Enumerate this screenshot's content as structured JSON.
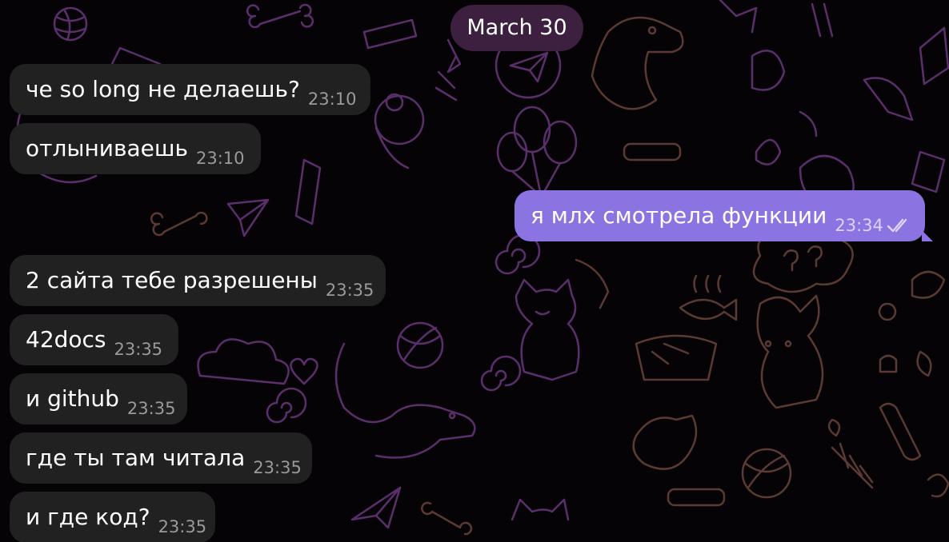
{
  "date_separator": "March 30",
  "messages": [
    {
      "direction": "incoming",
      "text": "че so long не делаешь?",
      "time": "23:10"
    },
    {
      "direction": "incoming",
      "text": "отлыниваешь",
      "time": "23:10"
    },
    {
      "direction": "outgoing",
      "text": "я млх смотрела функции",
      "time": "23:34",
      "status_icon": "double-check-icon"
    },
    {
      "direction": "incoming",
      "text": "2 сайта тебе разрешены",
      "time": "23:35"
    },
    {
      "direction": "incoming",
      "text": "42docs",
      "time": "23:35"
    },
    {
      "direction": "incoming",
      "text": "и github",
      "time": "23:35"
    },
    {
      "direction": "incoming",
      "text": "где ты там читала",
      "time": "23:35"
    },
    {
      "direction": "incoming",
      "text": "и где код?",
      "time": "23:35"
    }
  ],
  "colors": {
    "background": "#050306",
    "incoming_bubble": "#212121",
    "outgoing_bubble": "#8b74e2",
    "date_pill": "#3d1f3f",
    "wallpaper_doodle_purple": "#5b2f6b",
    "wallpaper_doodle_brown": "#5a3a33"
  }
}
